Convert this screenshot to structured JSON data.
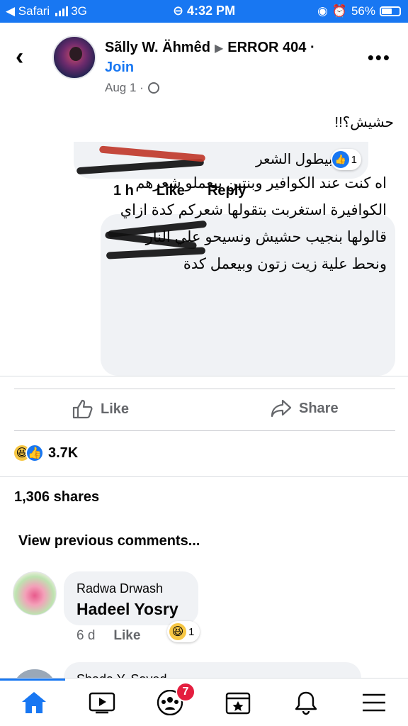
{
  "status_bar": {
    "back_app": "◀ Safari",
    "network": "3G",
    "time": "4:32 PM",
    "battery": "56%"
  },
  "post": {
    "author": "Sãlly W. Ähmêd",
    "group": "ERROR 404 ·",
    "join_label": "Join",
    "date": "Aug 1 ·",
    "text": "حشيش؟!!"
  },
  "embedded": {
    "comment1_text": "هو بيطول الشعر",
    "comment1_reactions": "1",
    "comment1_time": "1 h",
    "comment1_like": "Like",
    "comment1_reply": "Reply",
    "comment2_text": "اه كنت عند الكوافير وبنتين بيعملو شعرهم الكوافيرة استغربت بتقولها شعركم كدة ازاي قالولها بنجيب حشيش ونسيحو علي النار ونحط علية زيت زتون وبيعمل كدة"
  },
  "actions": {
    "like_label": "Like",
    "share_label": "Share"
  },
  "stats": {
    "reactions_count": "3.7K",
    "shares": "1,306 shares"
  },
  "comments": {
    "view_previous": "View previous comments...",
    "items": [
      {
        "name": "Radwa Drwash",
        "text": "Hadeel Yosry",
        "time": "6 d",
        "like": "Like",
        "reaction_count": "1"
      }
    ],
    "next_name": "Shada Y. Sayed"
  },
  "tabbar": {
    "groups_badge": "7"
  },
  "colors": {
    "brand": "#1877f2",
    "badge": "#e41e3f",
    "bubble": "#f0f2f5"
  }
}
